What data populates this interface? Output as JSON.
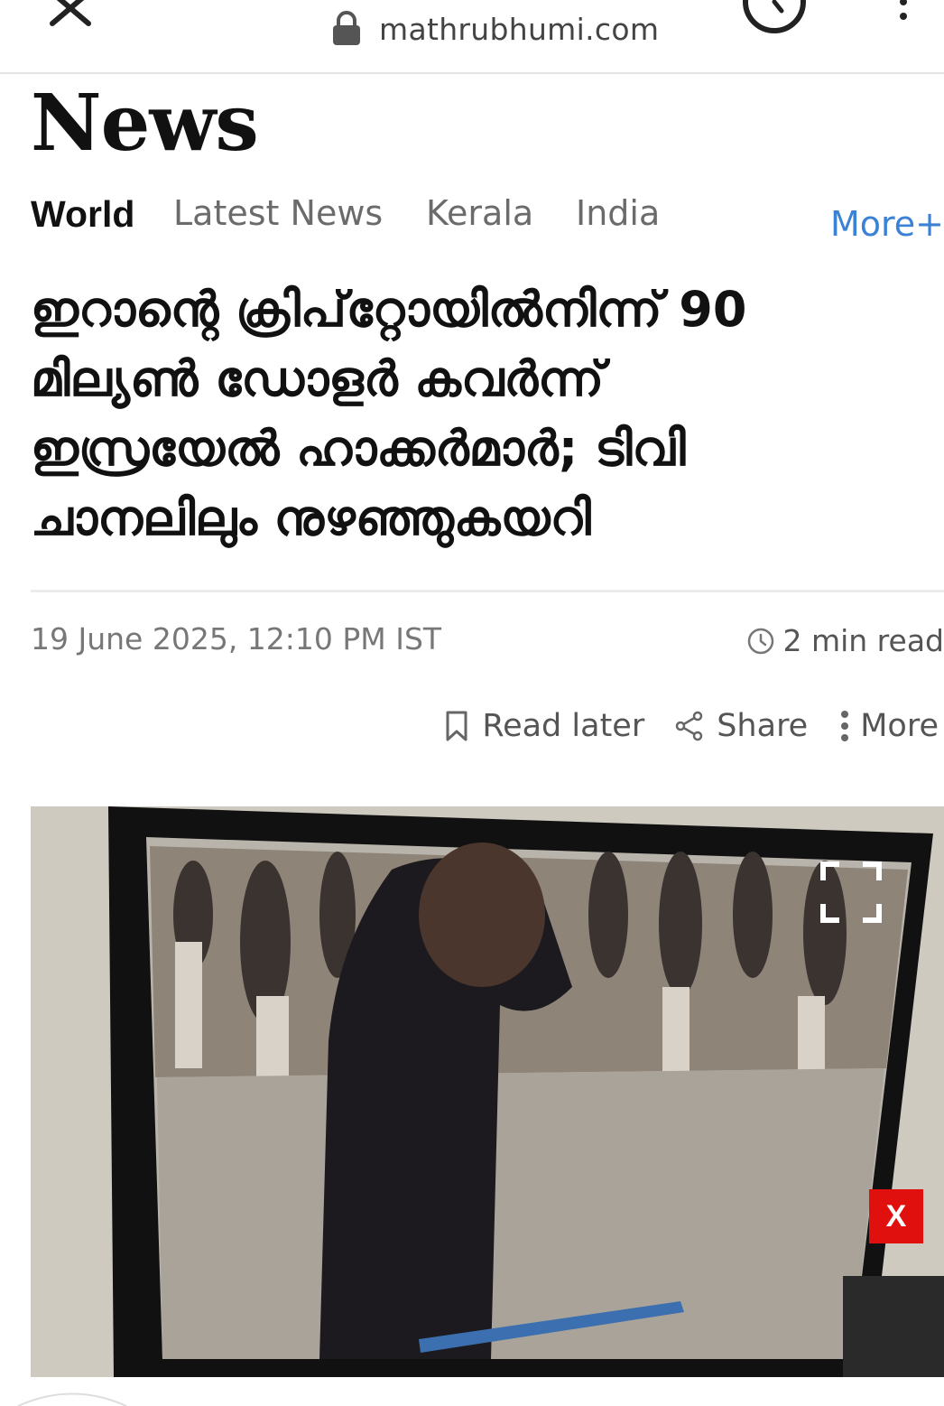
{
  "browser": {
    "url": "mathrubhumi.com",
    "icons": {
      "close": "close-icon",
      "lock": "lock-icon",
      "history": "history-icon",
      "menu": "more-vertical-icon"
    }
  },
  "section": {
    "title": "News"
  },
  "category_nav": {
    "items": [
      {
        "label": "World",
        "active": true
      },
      {
        "label": "Latest News",
        "active": false
      },
      {
        "label": "Kerala",
        "active": false
      },
      {
        "label": "India",
        "active": false
      }
    ],
    "more_label": "More+",
    "more_color": "#3b82d6"
  },
  "article": {
    "headline_lines": [
      "ഇറാന്റെ ക്രിപ്‌റ്റോയിൽനിന്ന് 90",
      "മില്യൺ ഡോളർ കവർന്ന്",
      "ഇസ്രയേൽ ഹാക്കർമാർ; ടിവി",
      "ചാനലിലും നുഴഞ്ഞുകയറി"
    ],
    "date": "19 June 2025, 12:10 PM IST",
    "read_time": "2 min read",
    "actions": {
      "read_later": "Read later",
      "share": "Share",
      "more": "More"
    },
    "image": {
      "close_label": "X",
      "close_color": "#e0100f"
    }
  }
}
